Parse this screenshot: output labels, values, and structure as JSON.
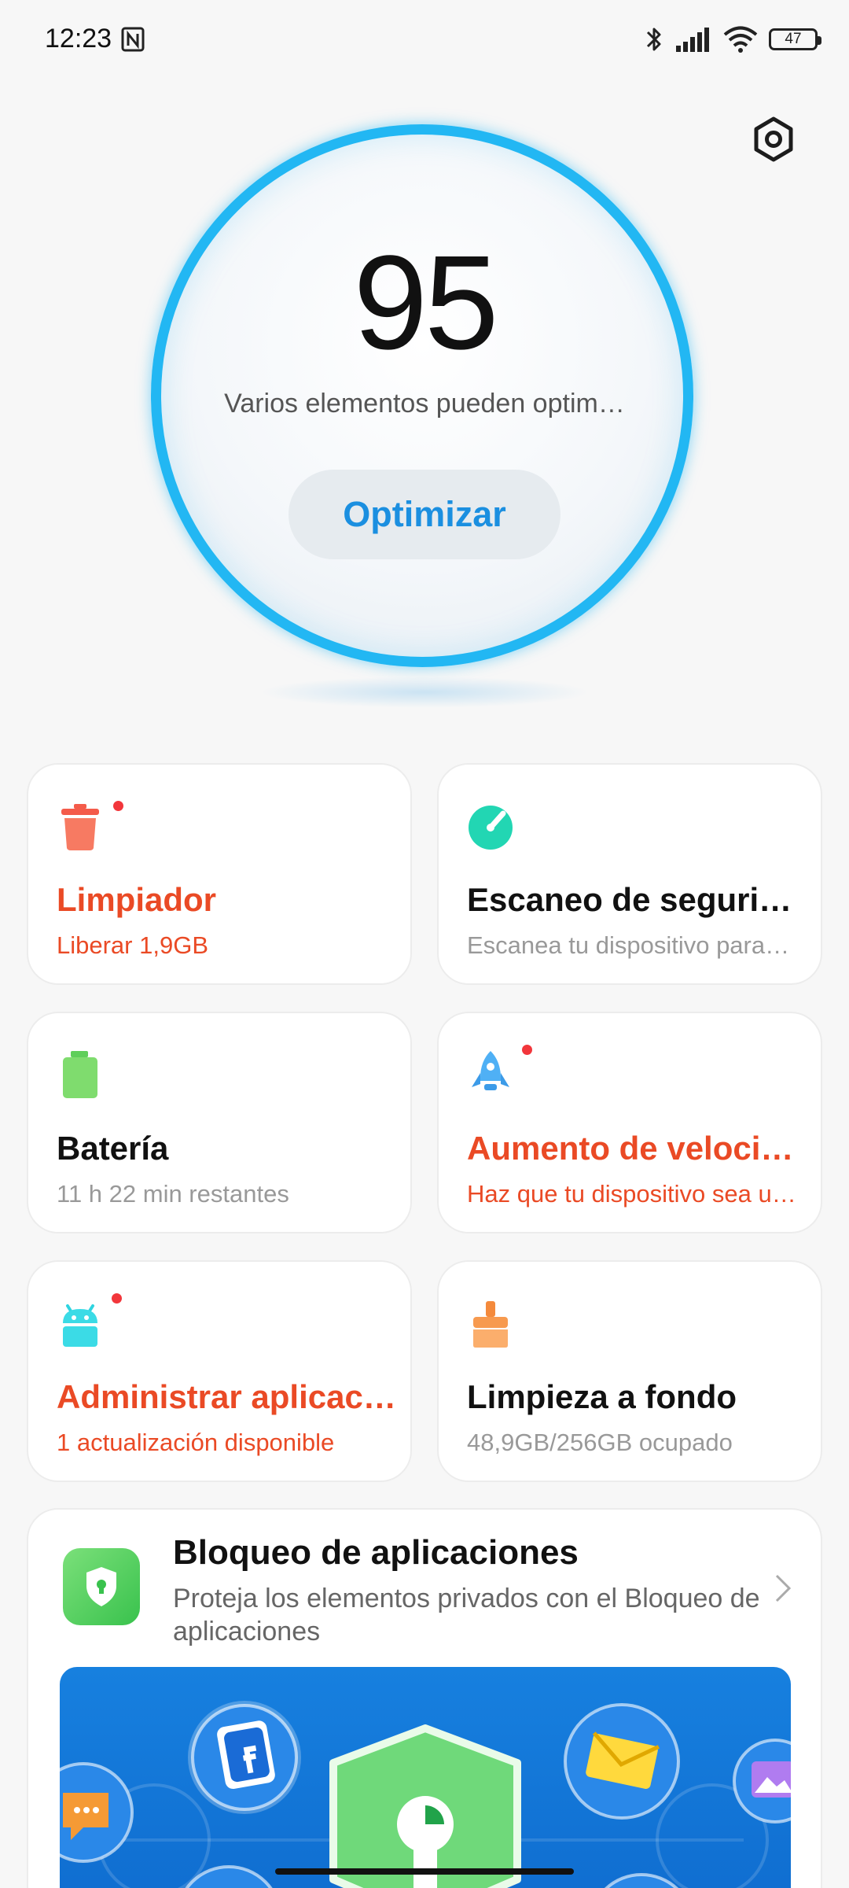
{
  "status_bar": {
    "time": "12:23",
    "battery_level": "47",
    "icons": [
      "nfc-icon",
      "bluetooth-icon",
      "signal-icon",
      "wifi-icon",
      "battery-icon"
    ]
  },
  "header": {
    "settings_icon": "gear-icon"
  },
  "score": {
    "value": "95",
    "subtitle": "Varios elementos pueden optim…",
    "button_label": "Optimizar",
    "ring_color": "#22b7f3"
  },
  "cards": [
    {
      "id": "cleaner",
      "title": "Limpiador",
      "subtitle": "Liberar 1,9GB",
      "icon": "trash-icon",
      "badge": true,
      "alert": true
    },
    {
      "id": "security",
      "title": "Escaneo de segurid…",
      "subtitle": "Escanea tu dispositivo para…",
      "icon": "security-scan-icon",
      "badge": false,
      "alert": false
    },
    {
      "id": "battery",
      "title": "Batería",
      "subtitle": "11 h 22 min  restantes",
      "icon": "battery-icon",
      "badge": false,
      "alert": false
    },
    {
      "id": "boost",
      "title": "Aumento de veloci…",
      "subtitle": "Haz que tu dispositivo sea u…",
      "icon": "rocket-icon",
      "badge": true,
      "alert": true
    },
    {
      "id": "apps",
      "title": "Administrar aplicac…",
      "subtitle": "1 actualización disponible",
      "icon": "android-icon",
      "badge": true,
      "alert": true
    },
    {
      "id": "deepclean",
      "title": "Limpieza a fondo",
      "subtitle": "48,9GB/256GB ocupado",
      "icon": "brush-icon",
      "badge": false,
      "alert": false
    }
  ],
  "app_lock": {
    "title": "Bloqueo de aplicaciones",
    "description": "Proteja los elementos privados con el Bloqueo de aplicaciones",
    "icon": "shield-lock-icon",
    "banner_icons": [
      "facebook-icon",
      "mail-icon",
      "gallery-icon",
      "chat-icon",
      "keyhole-shield-icon"
    ]
  },
  "colors": {
    "accent_blue": "#1b8fe0",
    "alert_red": "#ea4a25",
    "badge_red": "#f2363b",
    "muted_text": "#999999"
  }
}
